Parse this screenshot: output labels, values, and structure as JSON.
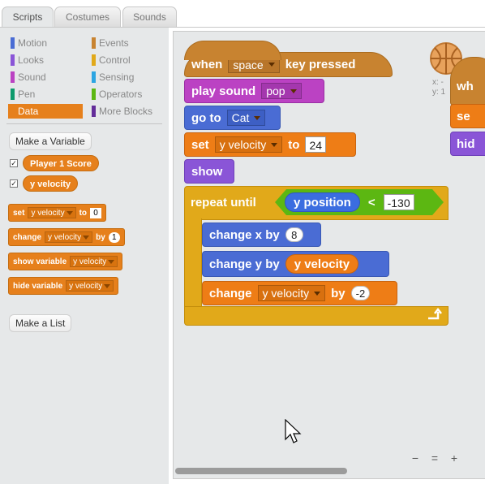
{
  "tabs": [
    "Scripts",
    "Costumes",
    "Sounds"
  ],
  "categories": [
    {
      "label": "Motion",
      "color": "#4a6cd4"
    },
    {
      "label": "Events",
      "color": "#c88330"
    },
    {
      "label": "Looks",
      "color": "#8a55d7"
    },
    {
      "label": "Control",
      "color": "#e1a91a"
    },
    {
      "label": "Sound",
      "color": "#bb42c3"
    },
    {
      "label": "Sensing",
      "color": "#2ca5e2"
    },
    {
      "label": "Pen",
      "color": "#0e9a6c"
    },
    {
      "label": "Operators",
      "color": "#5cb712"
    },
    {
      "label": "Data",
      "color": "#ee7d16"
    },
    {
      "label": "More Blocks",
      "color": "#632d99"
    }
  ],
  "palette": {
    "make_variable": "Make a Variable",
    "make_list": "Make a List",
    "variables": [
      "Player 1 Score",
      "y velocity"
    ],
    "set_block": {
      "set": "set",
      "var": "y velocity",
      "to": "to",
      "val": "0"
    },
    "change_block": {
      "change": "change",
      "var": "y velocity",
      "by": "by",
      "val": "1"
    },
    "show_block": {
      "label": "show variable",
      "var": "y velocity"
    },
    "hide_block": {
      "label": "hide variable",
      "var": "y velocity"
    }
  },
  "script": {
    "hat": {
      "when": "when",
      "key": "space",
      "pressed": "key pressed"
    },
    "play": {
      "label": "play sound",
      "sound": "pop"
    },
    "goto": {
      "label": "go to",
      "target": "Cat"
    },
    "set": {
      "set": "set",
      "var": "y velocity",
      "to": "to",
      "val": "24"
    },
    "show": "show",
    "repeat": {
      "label": "repeat until",
      "reporter": "y position",
      "op": "<",
      "val": "-130"
    },
    "change_x": {
      "label": "change x by",
      "val": "8"
    },
    "change_y": {
      "label": "change y by",
      "reporter": "y velocity"
    },
    "change_var": {
      "change": "change",
      "var": "y velocity",
      "by": "by",
      "val": "-2"
    }
  },
  "sprite_coords": {
    "x": "x: -",
    "y": "y: 1"
  },
  "other_script": {
    "when": "wh",
    "set": "se",
    "hide": "hid"
  },
  "zoom": {
    "out": "−",
    "reset": "=",
    "in": "+"
  }
}
